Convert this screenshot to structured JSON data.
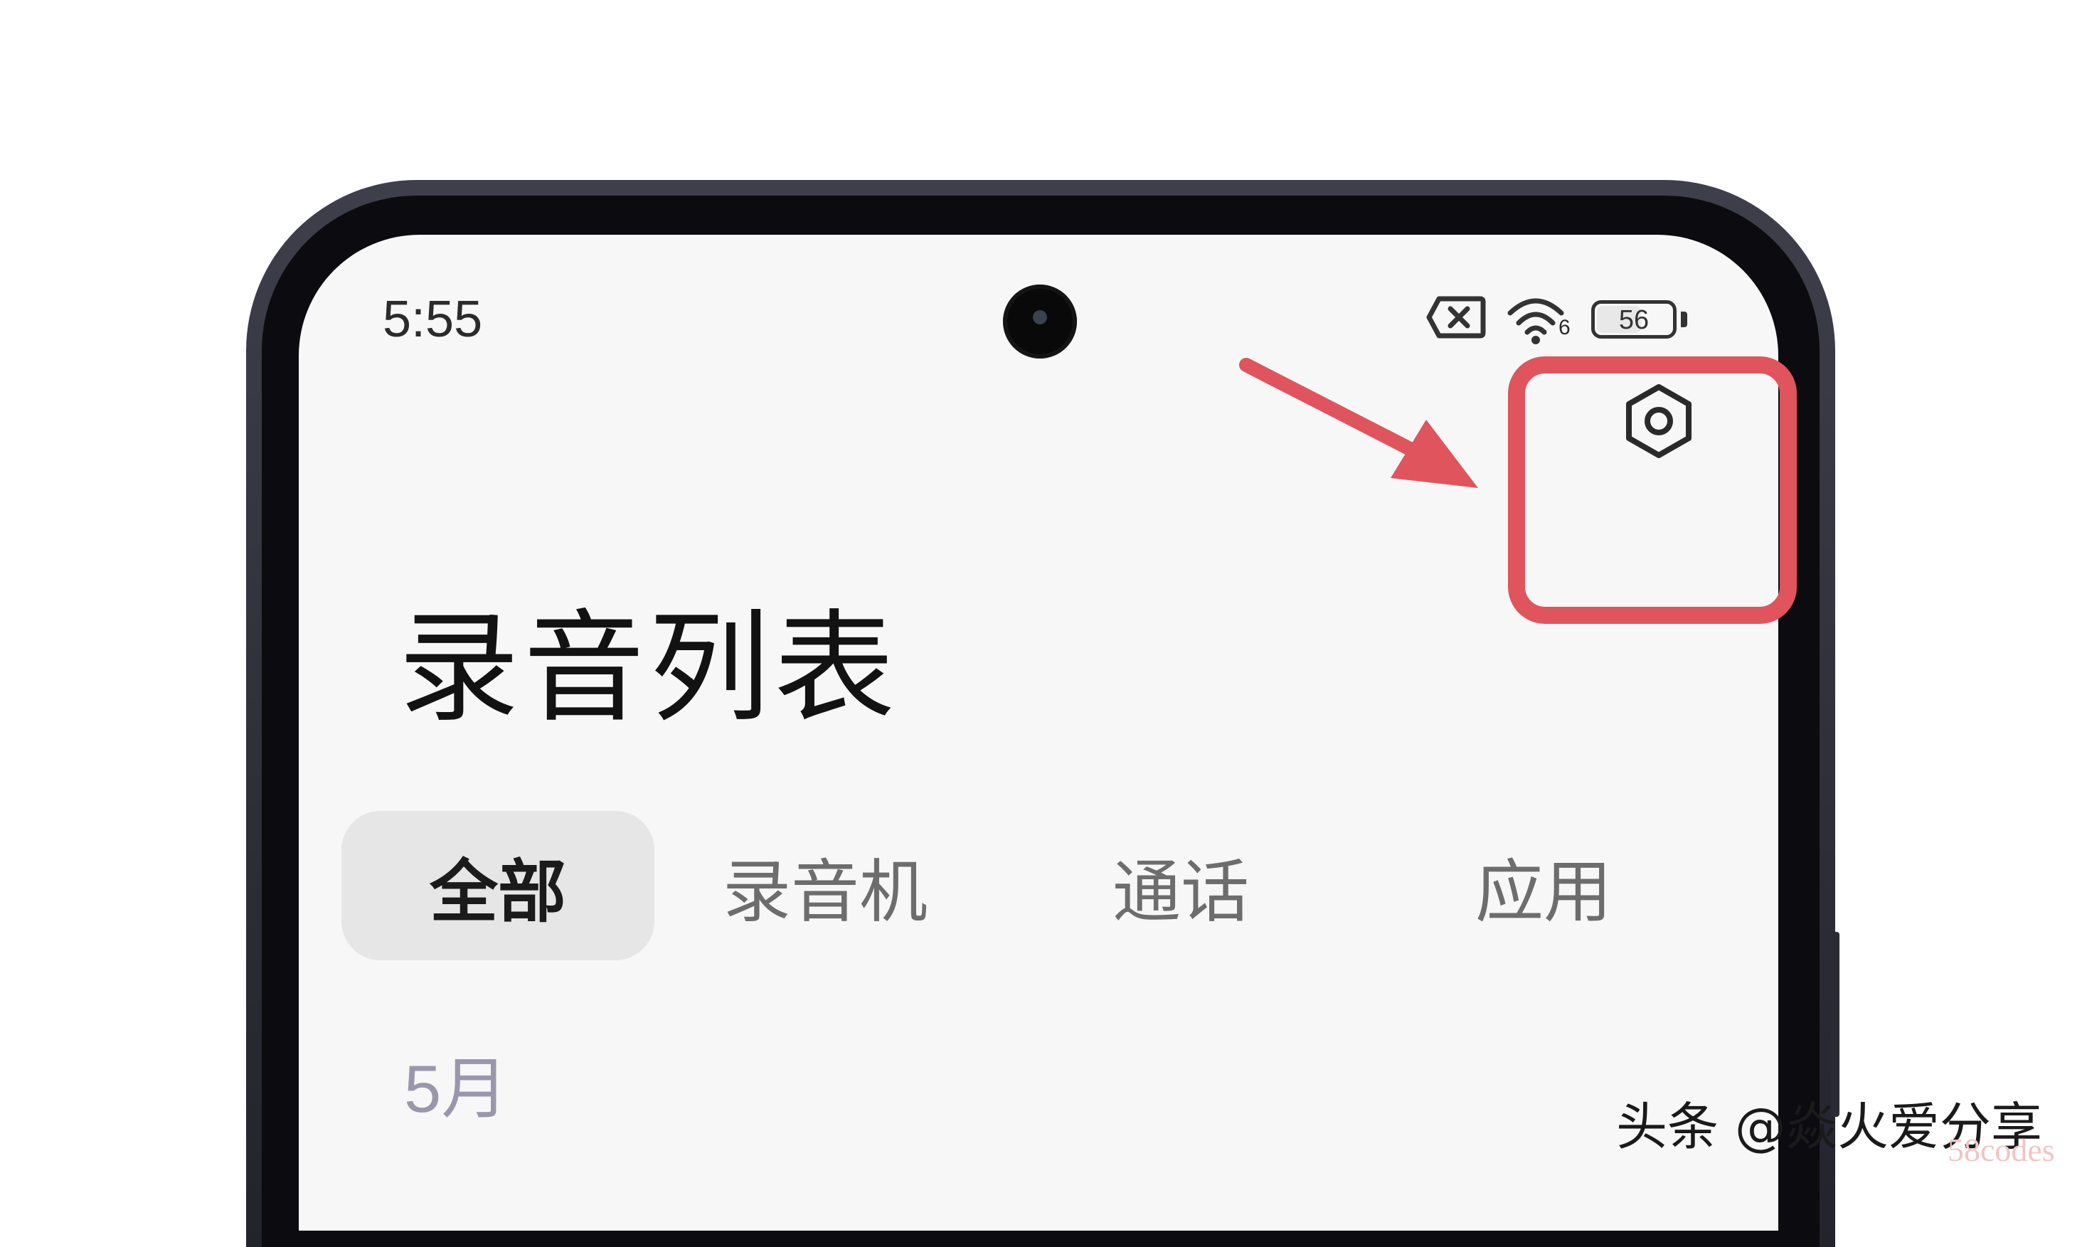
{
  "status_bar": {
    "time": "5:55",
    "battery_level": "56",
    "wifi_label": "6"
  },
  "header": {
    "settings_icon": "settings-hex-icon",
    "title": "录音列表"
  },
  "tabs": [
    {
      "label": "全部",
      "active": true
    },
    {
      "label": "录音机",
      "active": false
    },
    {
      "label": "通话",
      "active": false
    },
    {
      "label": "应用",
      "active": false
    }
  ],
  "list": {
    "section_label": "5月"
  },
  "annotation": {
    "highlight_color": "#e0545e",
    "arrow_color": "#e0545e"
  },
  "watermark": {
    "text": "头条 @焱火爱分享",
    "secondary": "58codes"
  }
}
